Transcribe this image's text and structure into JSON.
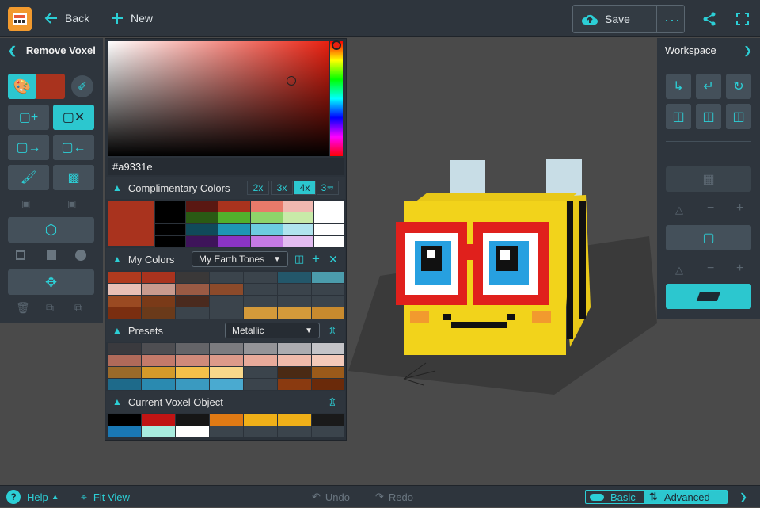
{
  "toolbar": {
    "back_label": "Back",
    "new_label": "New",
    "save_label": "Save"
  },
  "left_panel": {
    "title": "Remove Voxel"
  },
  "right_panel": {
    "title": "Workspace"
  },
  "color_picker": {
    "hex_value": "#a9331e",
    "complimentary": {
      "title": "Complimentary Colors",
      "zoom_options": [
        "2x",
        "3x",
        "4x",
        "3≂"
      ],
      "selected_zoom": "4x"
    },
    "my_colors": {
      "title": "My Colors",
      "palette_selected": "My Earth Tones"
    },
    "presets": {
      "title": "Presets",
      "preset_selected": "Metallic"
    },
    "current_object": {
      "title": "Current Voxel Object"
    }
  },
  "bottom_bar": {
    "help_label": "Help",
    "fit_view_label": "Fit View",
    "undo_label": "Undo",
    "redo_label": "Redo",
    "basic_label": "Basic",
    "advanced_label": "Advanced"
  },
  "colors": {
    "accent": "#2ccfd6",
    "selected_color": "#a9331e"
  }
}
